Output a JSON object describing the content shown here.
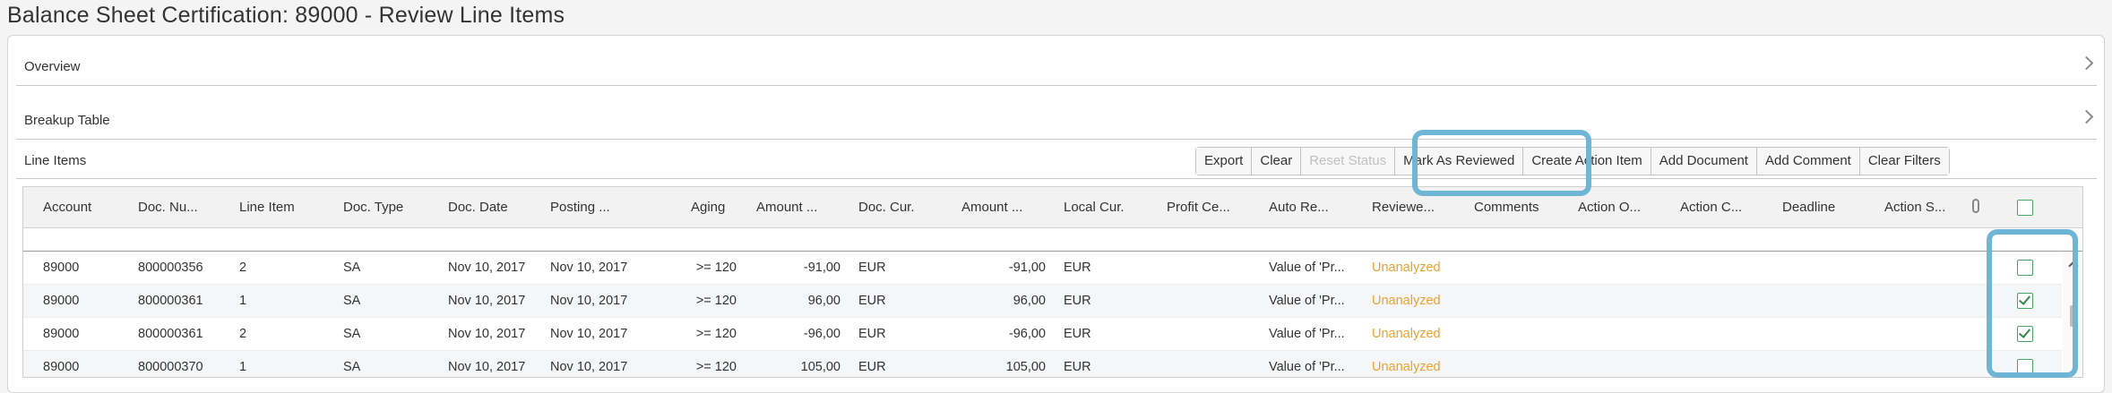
{
  "page": {
    "title": "Balance Sheet Certification: 89000 - Review Line Items"
  },
  "sections": {
    "overview": "Overview",
    "breakup_table": "Breakup Table",
    "line_items": "Line Items"
  },
  "toolbar": {
    "export": "Export",
    "clear": "Clear",
    "reset_status": "Reset Status",
    "mark_as_reviewed": "Mark As Reviewed",
    "create_action_item": "Create Action Item",
    "add_document": "Add Document",
    "add_comment": "Add Comment",
    "clear_filters": "Clear Filters"
  },
  "table": {
    "columns": [
      "Account",
      "Doc. Nu...",
      "Line Item",
      "Doc. Type",
      "Doc. Date",
      "Posting ...",
      "Aging",
      "Amount ...",
      "Doc. Cur.",
      "Amount ...",
      "Local Cur.",
      "Profit Ce...",
      "Auto Re...",
      "Reviewe...",
      "Comments",
      "Action O...",
      "Action C...",
      "Deadline",
      "Action S..."
    ],
    "rows": [
      {
        "account": "89000",
        "doc_number": "800000356",
        "line_item": "2",
        "doc_type": "SA",
        "doc_date": "Nov 10, 2017",
        "posting_date": "Nov 10, 2017",
        "aging": ">= 120",
        "amount_doc": "-91,00",
        "doc_cur": "EUR",
        "amount_local": "-91,00",
        "local_cur": "EUR",
        "auto_review": "Value of 'Pr...",
        "reviewed": "Unanalyzed",
        "checked": false
      },
      {
        "account": "89000",
        "doc_number": "800000361",
        "line_item": "1",
        "doc_type": "SA",
        "doc_date": "Nov 10, 2017",
        "posting_date": "Nov 10, 2017",
        "aging": ">= 120",
        "amount_doc": "96,00",
        "doc_cur": "EUR",
        "amount_local": "96,00",
        "local_cur": "EUR",
        "auto_review": "Value of 'Pr...",
        "reviewed": "Unanalyzed",
        "checked": true
      },
      {
        "account": "89000",
        "doc_number": "800000361",
        "line_item": "2",
        "doc_type": "SA",
        "doc_date": "Nov 10, 2017",
        "posting_date": "Nov 10, 2017",
        "aging": ">= 120",
        "amount_doc": "-96,00",
        "doc_cur": "EUR",
        "amount_local": "-96,00",
        "local_cur": "EUR",
        "auto_review": "Value of 'Pr...",
        "reviewed": "Unanalyzed",
        "checked": true
      },
      {
        "account": "89000",
        "doc_number": "800000370",
        "line_item": "1",
        "doc_type": "SA",
        "doc_date": "Nov 10, 2017",
        "posting_date": "Nov 10, 2017",
        "aging": ">= 120",
        "amount_doc": "105,00",
        "doc_cur": "EUR",
        "amount_local": "105,00",
        "local_cur": "EUR",
        "auto_review": "Value of 'Pr...",
        "reviewed": "Unanalyzed",
        "checked": false
      }
    ]
  },
  "icons": {
    "chevron": "chevron-right-icon",
    "attachment": "paperclip-icon",
    "checkbox": "checkbox-icon"
  },
  "colors": {
    "highlight": "#6fb6d6",
    "status_unanalyzed": "#f0a12a",
    "checkbox": "#4aa564"
  }
}
